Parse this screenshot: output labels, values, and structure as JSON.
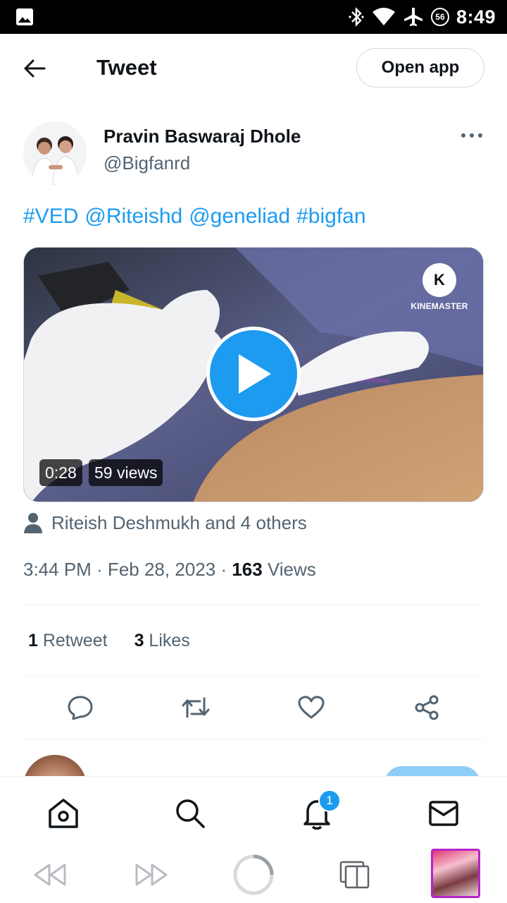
{
  "status_bar": {
    "time": "8:49",
    "battery_badge": "56",
    "icons": [
      "gallery-icon",
      "bluetooth-icon",
      "wifi-icon",
      "airplane-icon"
    ]
  },
  "header": {
    "title": "Tweet",
    "open_app_label": "Open app"
  },
  "tweet": {
    "author_name": "Pravin Baswaraj Dhole",
    "author_handle": "@Bigfanrd",
    "text_parts": [
      "#VED",
      "@Riteishd",
      "@geneliad",
      "#bigfan"
    ],
    "media": {
      "duration": "0:28",
      "views": "59 views",
      "watermark": "KINEMASTER",
      "watermark_letter": "K"
    },
    "tagged": "Riteish Deshmukh and 4 others",
    "timestamp": "3:44 PM · Feb 28, 2023 · ",
    "view_count": "163",
    "view_label": " Views",
    "retweet_count": "1",
    "retweet_label": " Retweet",
    "like_count": "3",
    "like_label": " Likes"
  },
  "bottom_nav": {
    "items": [
      "home-icon",
      "search-icon",
      "notifications-icon",
      "messages-icon"
    ],
    "notification_count": "1"
  },
  "colors": {
    "accent": "#1d9bf0",
    "text_primary": "#0f1419",
    "text_secondary": "#536471"
  }
}
